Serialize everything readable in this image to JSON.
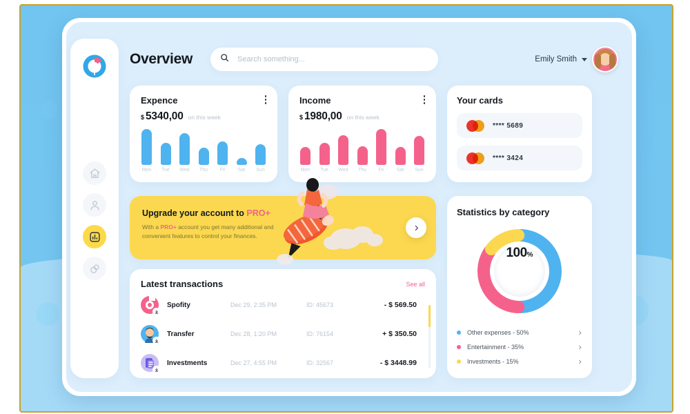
{
  "header": {
    "page_title": "Overview",
    "search": {
      "placeholder": "Search something...",
      "value": "",
      "icon": "search-icon"
    },
    "user": {
      "name": "Emily Smith",
      "chevron_icon": "chevron-down-icon",
      "avatar_icon": "avatar"
    }
  },
  "sidebar": {
    "logo_icon": "logo-donut-icon",
    "items": [
      {
        "icon": "home-icon",
        "active": false
      },
      {
        "icon": "user-icon",
        "active": false
      },
      {
        "icon": "chart-icon",
        "active": true
      },
      {
        "icon": "link-icon",
        "active": false
      }
    ]
  },
  "expense": {
    "title": "Expence",
    "currency": "$",
    "amount": "5340,00",
    "period": "on this week",
    "menu_icon": "more-vertical-icon"
  },
  "income": {
    "title": "Income",
    "currency": "$",
    "amount": "1980,00",
    "period": "on this week",
    "menu_icon": "more-vertical-icon"
  },
  "cards": {
    "title": "Your cards",
    "items": [
      {
        "brand_icon": "mastercard-icon",
        "number": "**** 5689"
      },
      {
        "brand_icon": "mastercard-icon",
        "number": "**** 3424"
      }
    ]
  },
  "promo": {
    "title_prefix": "Upgrade your account to ",
    "title_highlight": "PRO+",
    "desc_part1": "With a ",
    "desc_highlight": "PRO+",
    "desc_part2": " account you get many additional and convenient features to control your finances.",
    "arrow_icon": "chevron-right-icon",
    "illustration_icon": "rocket-illustration"
  },
  "transactions": {
    "title": "Latest transactions",
    "see_all": "See all",
    "rows": [
      {
        "icon": "spotify-icon",
        "name": "Spofity",
        "date": "Dec 29, 2:35 PM",
        "id": "ID: 45673",
        "amount": "- $ 569.50",
        "badge_icon": "download-icon"
      },
      {
        "icon": "transfer-avatar-icon",
        "name": "Transfer",
        "date": "Dec 28, 1:20 PM",
        "id": "ID: 76154",
        "amount": "+ $ 350.50",
        "badge_icon": "download-icon"
      },
      {
        "icon": "investments-icon",
        "name": "Investments",
        "date": "Dec 27, 4:55 PM",
        "id": "ID: 32567",
        "amount": "- $ 3448.99",
        "badge_icon": "download-icon"
      }
    ]
  },
  "statistics": {
    "title": "Statistics by category",
    "center_value": "100",
    "center_unit": "%",
    "legend": [
      {
        "label": "Other expenses - 50%",
        "color": "#4fb3ef",
        "arrow_icon": "chevron-right-icon"
      },
      {
        "label": "Entertainment - 35%",
        "color": "#f4628b",
        "arrow_icon": "chevron-right-icon"
      },
      {
        "label": "Investments - 15%",
        "color": "#fbd84f",
        "arrow_icon": "chevron-right-icon"
      }
    ]
  },
  "colors": {
    "expense_bar": "#4fb3ef",
    "income_bar": "#f4628b",
    "accent_yellow": "#fbd84f",
    "accent_pink": "#f4628b",
    "accent_blue": "#4fb3ef"
  },
  "chart_data": [
    {
      "type": "bar",
      "title": "Expence",
      "categories": [
        "Mon",
        "Tue",
        "Wed",
        "Thu",
        "Fri",
        "Sat",
        "Sun"
      ],
      "values": [
        100,
        62,
        88,
        48,
        66,
        20,
        58
      ],
      "xlabel": "",
      "ylabel": "",
      "ylim": [
        0,
        100
      ],
      "color": "#4fb3ef"
    },
    {
      "type": "bar",
      "title": "Income",
      "categories": [
        "Mon",
        "Tue",
        "Wed",
        "Thu",
        "Fri",
        "Sat",
        "Sun"
      ],
      "values": [
        50,
        62,
        82,
        52,
        100,
        50,
        80
      ],
      "xlabel": "",
      "ylabel": "",
      "ylim": [
        0,
        100
      ],
      "color": "#f4628b"
    },
    {
      "type": "pie",
      "title": "Statistics by category",
      "labels": [
        "Other expenses",
        "Entertainment",
        "Investments"
      ],
      "values": [
        50,
        35,
        15
      ],
      "colors": [
        "#4fb3ef",
        "#f4628b",
        "#fbd84f"
      ],
      "legend_position": "bottom",
      "center_label": "100%"
    }
  ]
}
